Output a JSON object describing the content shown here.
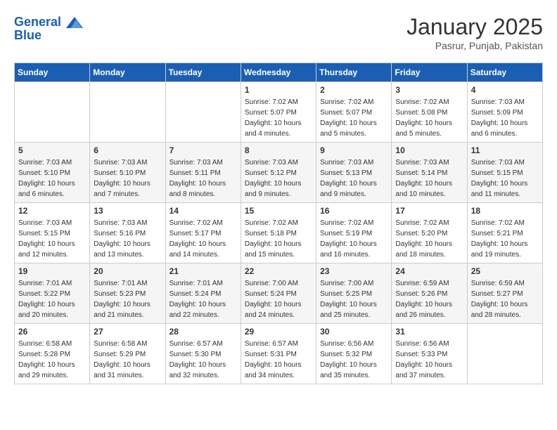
{
  "header": {
    "logo_line1": "General",
    "logo_line2": "Blue",
    "month": "January 2025",
    "location": "Pasrur, Punjab, Pakistan"
  },
  "weekdays": [
    "Sunday",
    "Monday",
    "Tuesday",
    "Wednesday",
    "Thursday",
    "Friday",
    "Saturday"
  ],
  "weeks": [
    [
      {
        "day": "",
        "info": ""
      },
      {
        "day": "",
        "info": ""
      },
      {
        "day": "",
        "info": ""
      },
      {
        "day": "1",
        "sunrise": "Sunrise: 7:02 AM",
        "sunset": "Sunset: 5:07 PM",
        "daylight": "Daylight: 10 hours and 4 minutes."
      },
      {
        "day": "2",
        "sunrise": "Sunrise: 7:02 AM",
        "sunset": "Sunset: 5:07 PM",
        "daylight": "Daylight: 10 hours and 5 minutes."
      },
      {
        "day": "3",
        "sunrise": "Sunrise: 7:02 AM",
        "sunset": "Sunset: 5:08 PM",
        "daylight": "Daylight: 10 hours and 5 minutes."
      },
      {
        "day": "4",
        "sunrise": "Sunrise: 7:03 AM",
        "sunset": "Sunset: 5:09 PM",
        "daylight": "Daylight: 10 hours and 6 minutes."
      }
    ],
    [
      {
        "day": "5",
        "sunrise": "Sunrise: 7:03 AM",
        "sunset": "Sunset: 5:10 PM",
        "daylight": "Daylight: 10 hours and 6 minutes."
      },
      {
        "day": "6",
        "sunrise": "Sunrise: 7:03 AM",
        "sunset": "Sunset: 5:10 PM",
        "daylight": "Daylight: 10 hours and 7 minutes."
      },
      {
        "day": "7",
        "sunrise": "Sunrise: 7:03 AM",
        "sunset": "Sunset: 5:11 PM",
        "daylight": "Daylight: 10 hours and 8 minutes."
      },
      {
        "day": "8",
        "sunrise": "Sunrise: 7:03 AM",
        "sunset": "Sunset: 5:12 PM",
        "daylight": "Daylight: 10 hours and 9 minutes."
      },
      {
        "day": "9",
        "sunrise": "Sunrise: 7:03 AM",
        "sunset": "Sunset: 5:13 PM",
        "daylight": "Daylight: 10 hours and 9 minutes."
      },
      {
        "day": "10",
        "sunrise": "Sunrise: 7:03 AM",
        "sunset": "Sunset: 5:14 PM",
        "daylight": "Daylight: 10 hours and 10 minutes."
      },
      {
        "day": "11",
        "sunrise": "Sunrise: 7:03 AM",
        "sunset": "Sunset: 5:15 PM",
        "daylight": "Daylight: 10 hours and 11 minutes."
      }
    ],
    [
      {
        "day": "12",
        "sunrise": "Sunrise: 7:03 AM",
        "sunset": "Sunset: 5:15 PM",
        "daylight": "Daylight: 10 hours and 12 minutes."
      },
      {
        "day": "13",
        "sunrise": "Sunrise: 7:03 AM",
        "sunset": "Sunset: 5:16 PM",
        "daylight": "Daylight: 10 hours and 13 minutes."
      },
      {
        "day": "14",
        "sunrise": "Sunrise: 7:02 AM",
        "sunset": "Sunset: 5:17 PM",
        "daylight": "Daylight: 10 hours and 14 minutes."
      },
      {
        "day": "15",
        "sunrise": "Sunrise: 7:02 AM",
        "sunset": "Sunset: 5:18 PM",
        "daylight": "Daylight: 10 hours and 15 minutes."
      },
      {
        "day": "16",
        "sunrise": "Sunrise: 7:02 AM",
        "sunset": "Sunset: 5:19 PM",
        "daylight": "Daylight: 10 hours and 16 minutes."
      },
      {
        "day": "17",
        "sunrise": "Sunrise: 7:02 AM",
        "sunset": "Sunset: 5:20 PM",
        "daylight": "Daylight: 10 hours and 18 minutes."
      },
      {
        "day": "18",
        "sunrise": "Sunrise: 7:02 AM",
        "sunset": "Sunset: 5:21 PM",
        "daylight": "Daylight: 10 hours and 19 minutes."
      }
    ],
    [
      {
        "day": "19",
        "sunrise": "Sunrise: 7:01 AM",
        "sunset": "Sunset: 5:22 PM",
        "daylight": "Daylight: 10 hours and 20 minutes."
      },
      {
        "day": "20",
        "sunrise": "Sunrise: 7:01 AM",
        "sunset": "Sunset: 5:23 PM",
        "daylight": "Daylight: 10 hours and 21 minutes."
      },
      {
        "day": "21",
        "sunrise": "Sunrise: 7:01 AM",
        "sunset": "Sunset: 5:24 PM",
        "daylight": "Daylight: 10 hours and 22 minutes."
      },
      {
        "day": "22",
        "sunrise": "Sunrise: 7:00 AM",
        "sunset": "Sunset: 5:24 PM",
        "daylight": "Daylight: 10 hours and 24 minutes."
      },
      {
        "day": "23",
        "sunrise": "Sunrise: 7:00 AM",
        "sunset": "Sunset: 5:25 PM",
        "daylight": "Daylight: 10 hours and 25 minutes."
      },
      {
        "day": "24",
        "sunrise": "Sunrise: 6:59 AM",
        "sunset": "Sunset: 5:26 PM",
        "daylight": "Daylight: 10 hours and 26 minutes."
      },
      {
        "day": "25",
        "sunrise": "Sunrise: 6:59 AM",
        "sunset": "Sunset: 5:27 PM",
        "daylight": "Daylight: 10 hours and 28 minutes."
      }
    ],
    [
      {
        "day": "26",
        "sunrise": "Sunrise: 6:58 AM",
        "sunset": "Sunset: 5:28 PM",
        "daylight": "Daylight: 10 hours and 29 minutes."
      },
      {
        "day": "27",
        "sunrise": "Sunrise: 6:58 AM",
        "sunset": "Sunset: 5:29 PM",
        "daylight": "Daylight: 10 hours and 31 minutes."
      },
      {
        "day": "28",
        "sunrise": "Sunrise: 6:57 AM",
        "sunset": "Sunset: 5:30 PM",
        "daylight": "Daylight: 10 hours and 32 minutes."
      },
      {
        "day": "29",
        "sunrise": "Sunrise: 6:57 AM",
        "sunset": "Sunset: 5:31 PM",
        "daylight": "Daylight: 10 hours and 34 minutes."
      },
      {
        "day": "30",
        "sunrise": "Sunrise: 6:56 AM",
        "sunset": "Sunset: 5:32 PM",
        "daylight": "Daylight: 10 hours and 35 minutes."
      },
      {
        "day": "31",
        "sunrise": "Sunrise: 6:56 AM",
        "sunset": "Sunset: 5:33 PM",
        "daylight": "Daylight: 10 hours and 37 minutes."
      },
      {
        "day": "",
        "info": ""
      }
    ]
  ]
}
